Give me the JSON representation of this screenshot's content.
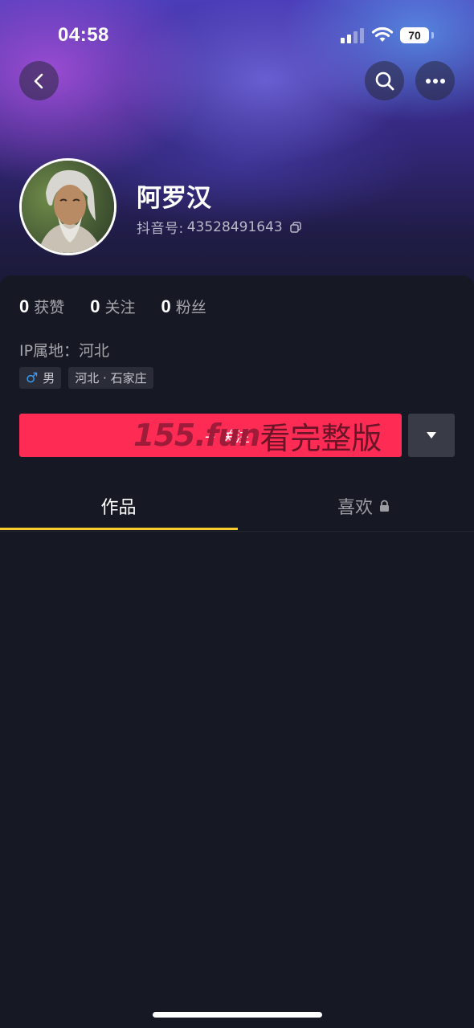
{
  "status_bar": {
    "time": "04:58",
    "battery": "70"
  },
  "header": {
    "back_icon": "chevron-left-icon",
    "search_icon": "search-icon",
    "more_icon": "more-horizontal-icon"
  },
  "profile": {
    "name": "阿罗汉",
    "account_label": "抖音号: ",
    "account_id": "43528491643",
    "copy_icon": "copy-icon"
  },
  "stats": [
    {
      "value": "0",
      "label": "获赞"
    },
    {
      "value": "0",
      "label": "关注"
    },
    {
      "value": "0",
      "label": "粉丝"
    }
  ],
  "ip_location": "IP属地：河北",
  "tags": {
    "gender": "男",
    "region": "河北 · 石家庄"
  },
  "actions": {
    "follow_label": "+ 关注",
    "watermark_domain": "155.fun",
    "watermark_text": "看完整版",
    "follow_color": "#fe2c55"
  },
  "tabs": [
    {
      "label": "作品",
      "active": true
    },
    {
      "label": "喜欢",
      "locked": true
    }
  ],
  "colors": {
    "accent_yellow": "#facd2c",
    "background": "#161823"
  }
}
